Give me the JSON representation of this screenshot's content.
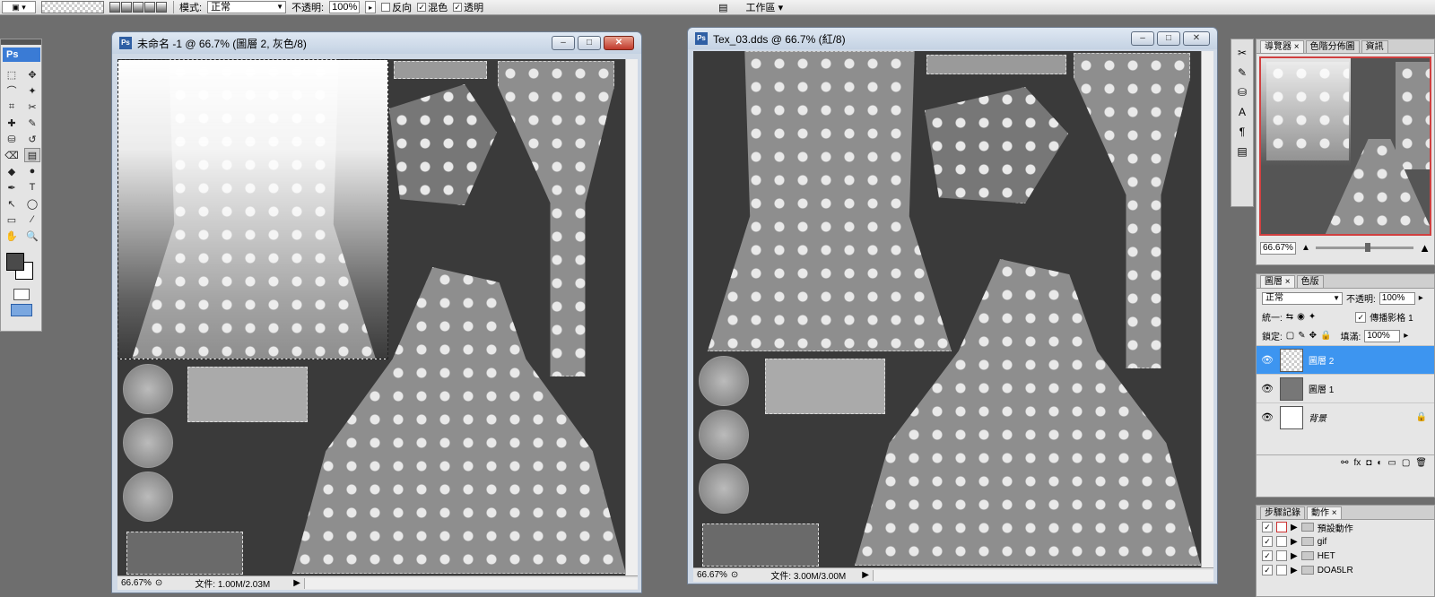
{
  "options_bar": {
    "mode_label": "模式:",
    "mode_value": "正常",
    "opacity_label": "不透明:",
    "opacity_value": "100%",
    "reverse_label": "反向",
    "dither_label": "混色",
    "transparency_label": "透明",
    "reverse_checked": false,
    "dither_checked": true,
    "transparency_checked": true,
    "workspace_label": "工作區 ▾"
  },
  "toolbox": {
    "logo": "Ps",
    "foreground_color": "#4a4a4a",
    "background_color": "#ffffff",
    "tools": [
      "marquee-icon",
      "move-icon",
      "lasso-icon",
      "magic-wand-icon",
      "crop-icon",
      "slice-icon",
      "healing-icon",
      "brush-icon",
      "stamp-icon",
      "history-brush-icon",
      "eraser-icon",
      "gradient-icon",
      "blur-icon",
      "dodge-icon",
      "pen-icon",
      "type-icon",
      "path-select-icon",
      "shape-icon",
      "notes-icon",
      "eyedropper-icon",
      "hand-icon",
      "zoom-icon"
    ],
    "tool_glyphs": [
      "⬚",
      "✥",
      "⌒",
      "✦",
      "⌗",
      "✂",
      "✚",
      "✎",
      "⛁",
      "↺",
      "⌫",
      "▤",
      "◆",
      "●",
      "✒",
      "T",
      "↖",
      "◯",
      "▭",
      "⁄",
      "✋",
      "🔍"
    ],
    "active_tool": "gradient-icon"
  },
  "window1": {
    "title": "未命名 -1 @ 66.7% (圖層 2, 灰色/8)",
    "zoom": "66.67%",
    "doc_info": "文件: 1.00M/2.03M"
  },
  "window2": {
    "title": "Tex_03.dds @ 66.7% (紅/8)",
    "zoom": "66.67%",
    "doc_info": "文件: 3.00M/3.00M"
  },
  "navigator_panel": {
    "tabs": [
      "導覽器 ×",
      "色階分佈圖",
      "資訊"
    ],
    "zoom": "66.67%"
  },
  "layers_panel": {
    "tabs": [
      "圖層 ×",
      "色版"
    ],
    "blend_mode": "正常",
    "opacity_label": "不透明:",
    "opacity_value": "100%",
    "unify_label": "統一:",
    "propagate_label": "傳播影格 1",
    "lock_label": "鎖定:",
    "fill_label": "填滿:",
    "fill_value": "100%",
    "layers": [
      {
        "name": "圖層 2",
        "selected": true,
        "locked": false
      },
      {
        "name": "圖層 1",
        "selected": false,
        "locked": false
      },
      {
        "name": "背景",
        "selected": false,
        "locked": true
      }
    ]
  },
  "actions_panel": {
    "tabs": [
      "步驟記錄",
      "動作 ×"
    ],
    "items": [
      {
        "name": "預設動作",
        "checked": true
      },
      {
        "name": "gif",
        "checked": true
      },
      {
        "name": "HET",
        "checked": true
      },
      {
        "name": "DOA5LR",
        "checked": true
      }
    ]
  }
}
